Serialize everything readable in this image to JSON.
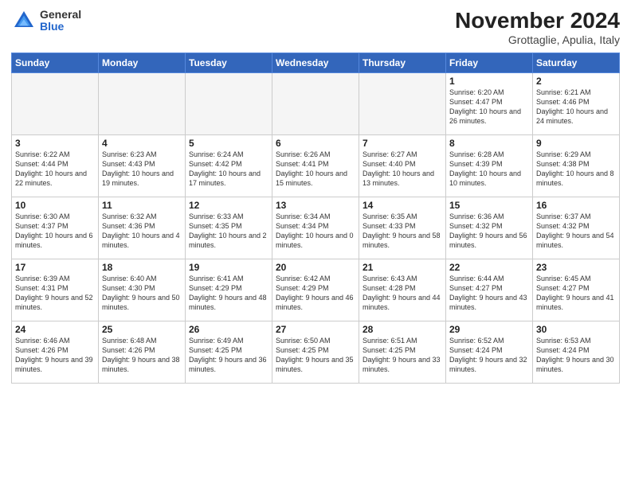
{
  "logo": {
    "general": "General",
    "blue": "Blue"
  },
  "header": {
    "month": "November 2024",
    "location": "Grottaglie, Apulia, Italy"
  },
  "weekdays": [
    "Sunday",
    "Monday",
    "Tuesday",
    "Wednesday",
    "Thursday",
    "Friday",
    "Saturday"
  ],
  "weeks": [
    [
      {
        "day": "",
        "info": ""
      },
      {
        "day": "",
        "info": ""
      },
      {
        "day": "",
        "info": ""
      },
      {
        "day": "",
        "info": ""
      },
      {
        "day": "",
        "info": ""
      },
      {
        "day": "1",
        "info": "Sunrise: 6:20 AM\nSunset: 4:47 PM\nDaylight: 10 hours and 26 minutes."
      },
      {
        "day": "2",
        "info": "Sunrise: 6:21 AM\nSunset: 4:46 PM\nDaylight: 10 hours and 24 minutes."
      }
    ],
    [
      {
        "day": "3",
        "info": "Sunrise: 6:22 AM\nSunset: 4:44 PM\nDaylight: 10 hours and 22 minutes."
      },
      {
        "day": "4",
        "info": "Sunrise: 6:23 AM\nSunset: 4:43 PM\nDaylight: 10 hours and 19 minutes."
      },
      {
        "day": "5",
        "info": "Sunrise: 6:24 AM\nSunset: 4:42 PM\nDaylight: 10 hours and 17 minutes."
      },
      {
        "day": "6",
        "info": "Sunrise: 6:26 AM\nSunset: 4:41 PM\nDaylight: 10 hours and 15 minutes."
      },
      {
        "day": "7",
        "info": "Sunrise: 6:27 AM\nSunset: 4:40 PM\nDaylight: 10 hours and 13 minutes."
      },
      {
        "day": "8",
        "info": "Sunrise: 6:28 AM\nSunset: 4:39 PM\nDaylight: 10 hours and 10 minutes."
      },
      {
        "day": "9",
        "info": "Sunrise: 6:29 AM\nSunset: 4:38 PM\nDaylight: 10 hours and 8 minutes."
      }
    ],
    [
      {
        "day": "10",
        "info": "Sunrise: 6:30 AM\nSunset: 4:37 PM\nDaylight: 10 hours and 6 minutes."
      },
      {
        "day": "11",
        "info": "Sunrise: 6:32 AM\nSunset: 4:36 PM\nDaylight: 10 hours and 4 minutes."
      },
      {
        "day": "12",
        "info": "Sunrise: 6:33 AM\nSunset: 4:35 PM\nDaylight: 10 hours and 2 minutes."
      },
      {
        "day": "13",
        "info": "Sunrise: 6:34 AM\nSunset: 4:34 PM\nDaylight: 10 hours and 0 minutes."
      },
      {
        "day": "14",
        "info": "Sunrise: 6:35 AM\nSunset: 4:33 PM\nDaylight: 9 hours and 58 minutes."
      },
      {
        "day": "15",
        "info": "Sunrise: 6:36 AM\nSunset: 4:32 PM\nDaylight: 9 hours and 56 minutes."
      },
      {
        "day": "16",
        "info": "Sunrise: 6:37 AM\nSunset: 4:32 PM\nDaylight: 9 hours and 54 minutes."
      }
    ],
    [
      {
        "day": "17",
        "info": "Sunrise: 6:39 AM\nSunset: 4:31 PM\nDaylight: 9 hours and 52 minutes."
      },
      {
        "day": "18",
        "info": "Sunrise: 6:40 AM\nSunset: 4:30 PM\nDaylight: 9 hours and 50 minutes."
      },
      {
        "day": "19",
        "info": "Sunrise: 6:41 AM\nSunset: 4:29 PM\nDaylight: 9 hours and 48 minutes."
      },
      {
        "day": "20",
        "info": "Sunrise: 6:42 AM\nSunset: 4:29 PM\nDaylight: 9 hours and 46 minutes."
      },
      {
        "day": "21",
        "info": "Sunrise: 6:43 AM\nSunset: 4:28 PM\nDaylight: 9 hours and 44 minutes."
      },
      {
        "day": "22",
        "info": "Sunrise: 6:44 AM\nSunset: 4:27 PM\nDaylight: 9 hours and 43 minutes."
      },
      {
        "day": "23",
        "info": "Sunrise: 6:45 AM\nSunset: 4:27 PM\nDaylight: 9 hours and 41 minutes."
      }
    ],
    [
      {
        "day": "24",
        "info": "Sunrise: 6:46 AM\nSunset: 4:26 PM\nDaylight: 9 hours and 39 minutes."
      },
      {
        "day": "25",
        "info": "Sunrise: 6:48 AM\nSunset: 4:26 PM\nDaylight: 9 hours and 38 minutes."
      },
      {
        "day": "26",
        "info": "Sunrise: 6:49 AM\nSunset: 4:25 PM\nDaylight: 9 hours and 36 minutes."
      },
      {
        "day": "27",
        "info": "Sunrise: 6:50 AM\nSunset: 4:25 PM\nDaylight: 9 hours and 35 minutes."
      },
      {
        "day": "28",
        "info": "Sunrise: 6:51 AM\nSunset: 4:25 PM\nDaylight: 9 hours and 33 minutes."
      },
      {
        "day": "29",
        "info": "Sunrise: 6:52 AM\nSunset: 4:24 PM\nDaylight: 9 hours and 32 minutes."
      },
      {
        "day": "30",
        "info": "Sunrise: 6:53 AM\nSunset: 4:24 PM\nDaylight: 9 hours and 30 minutes."
      }
    ]
  ]
}
